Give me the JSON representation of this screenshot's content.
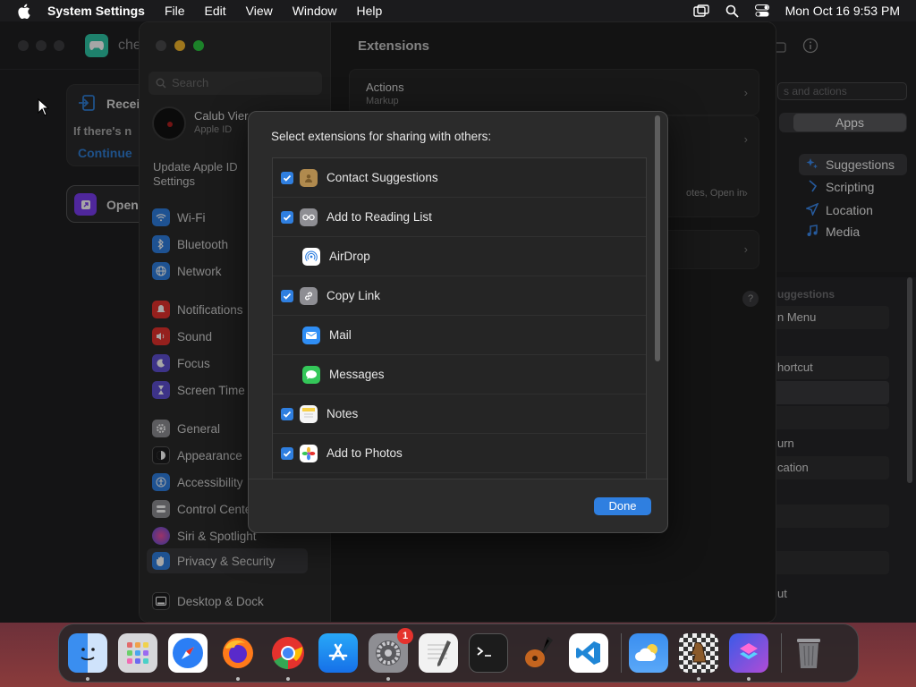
{
  "menubar": {
    "app_name": "System Settings",
    "menus": [
      "File",
      "Edit",
      "View",
      "Window",
      "Help"
    ],
    "datetime": "Mon Oct 16  9:53 PM"
  },
  "bg_left": {
    "app_title": "che",
    "receive_title": "Recei",
    "receive_desc": "If there's n",
    "receive_link": "Continue",
    "open_title": "Open"
  },
  "bg_right": {
    "search_placeholder": "s and actions",
    "segment_selected": "Apps",
    "categories": [
      {
        "label": "Suggestions",
        "icon": "sparkle-icon"
      },
      {
        "label": "Scripting",
        "icon": "scripting-icon"
      },
      {
        "label": "Location",
        "icon": "location-icon"
      },
      {
        "label": "Media",
        "icon": "music-note-icon"
      }
    ],
    "list_labels": [
      "uggestions",
      "n Menu",
      "hortcut",
      "urn",
      "cation",
      "ut"
    ]
  },
  "settings": {
    "search_placeholder": "Search",
    "user_name": "Calub Vier",
    "user_sub": "Apple ID",
    "update_appleid": "Update Apple ID Settings",
    "nav": [
      {
        "label": "Wi-Fi",
        "icon": "wifi-icon",
        "color": "#2f7fe0"
      },
      {
        "label": "Bluetooth",
        "icon": "bluetooth-icon",
        "color": "#2f7fe0"
      },
      {
        "label": "Network",
        "icon": "globe-icon",
        "color": "#2f7fe0"
      },
      {
        "label": "Notifications",
        "icon": "bell-icon",
        "color": "#e5322d"
      },
      {
        "label": "Sound",
        "icon": "speaker-icon",
        "color": "#e5322d"
      },
      {
        "label": "Focus",
        "icon": "moon-icon",
        "color": "#5e4fd1"
      },
      {
        "label": "Screen Time",
        "icon": "hourglass-icon",
        "color": "#5e4fd1"
      },
      {
        "label": "General",
        "icon": "gear-icon",
        "color": "#8e8e93"
      },
      {
        "label": "Appearance",
        "icon": "appearance-icon",
        "color": "#1c1c1e"
      },
      {
        "label": "Accessibility",
        "icon": "accessibility-icon",
        "color": "#2f7fe0"
      },
      {
        "label": "Control Cente",
        "icon": "control-center-icon",
        "color": "#8e8e93"
      },
      {
        "label": "Siri & Spotlight",
        "icon": "siri-icon",
        "color": "#d0409a"
      },
      {
        "label": "Privacy & Security",
        "icon": "hand-icon",
        "color": "#2f7fe0"
      },
      {
        "label": "Desktop & Dock",
        "icon": "dock-icon",
        "color": "#1c1c1e"
      }
    ],
    "content_title": "Extensions",
    "groups": [
      {
        "title": "Actions",
        "sub": "Markup"
      },
      {
        "title": "",
        "sub": "otes, Open in"
      }
    ]
  },
  "sheet": {
    "heading": "Select extensions for sharing with others:",
    "items": [
      {
        "label": "Contact Suggestions",
        "checked": true,
        "icon": "contacts-icon",
        "color": "#b08a4e"
      },
      {
        "label": "Add to Reading List",
        "checked": true,
        "icon": "glasses-icon",
        "color": "#8e8e93"
      },
      {
        "label": "AirDrop",
        "checked": false,
        "icon": "airdrop-icon",
        "color": "#ffffff"
      },
      {
        "label": "Copy Link",
        "checked": true,
        "icon": "link-icon",
        "color": "#8e8e93"
      },
      {
        "label": "Mail",
        "checked": false,
        "icon": "mail-icon",
        "color": "#2f8ef5"
      },
      {
        "label": "Messages",
        "checked": false,
        "icon": "messages-icon",
        "color": "#34c759"
      },
      {
        "label": "Notes",
        "checked": true,
        "icon": "notes-icon",
        "color": "#f5f5f5"
      },
      {
        "label": "Add to Photos",
        "checked": true,
        "icon": "photos-icon",
        "color": "#ffffff"
      }
    ],
    "done_label": "Done"
  },
  "dock": {
    "apps": [
      {
        "name": "finder-icon",
        "color": "#3a8ef0",
        "running": true
      },
      {
        "name": "launchpad-icon",
        "color": "#d7d7da",
        "running": false
      },
      {
        "name": "safari-icon",
        "color": "#2b7ef5",
        "running": false
      },
      {
        "name": "firefox-icon",
        "color": "#ff7a1a",
        "running": true
      },
      {
        "name": "chrome-icon",
        "color": "#ffffff",
        "running": true
      },
      {
        "name": "app-store-icon",
        "color": "#1d8ef5",
        "running": false
      },
      {
        "name": "system-settings-icon",
        "color": "#8e8e93",
        "running": true,
        "badge": "1"
      },
      {
        "name": "textedit-icon",
        "color": "#f2f2f2",
        "running": false
      },
      {
        "name": "terminal-icon",
        "color": "#1c1c1c",
        "running": false
      },
      {
        "name": "garageband-icon",
        "color": "#3a2a1a",
        "running": false
      },
      {
        "name": "vscode-icon",
        "color": "#1f86d6",
        "running": false
      }
    ],
    "apps_right": [
      {
        "name": "weather-icon",
        "color": "#3a8ef0",
        "running": false
      },
      {
        "name": "chess-icon",
        "color": "#dcdcdc",
        "running": true
      },
      {
        "name": "shortcuts-icon",
        "color": "#7a3cf0",
        "running": true
      }
    ],
    "trash": {
      "name": "trash-icon",
      "color": "#8e8e93"
    }
  }
}
